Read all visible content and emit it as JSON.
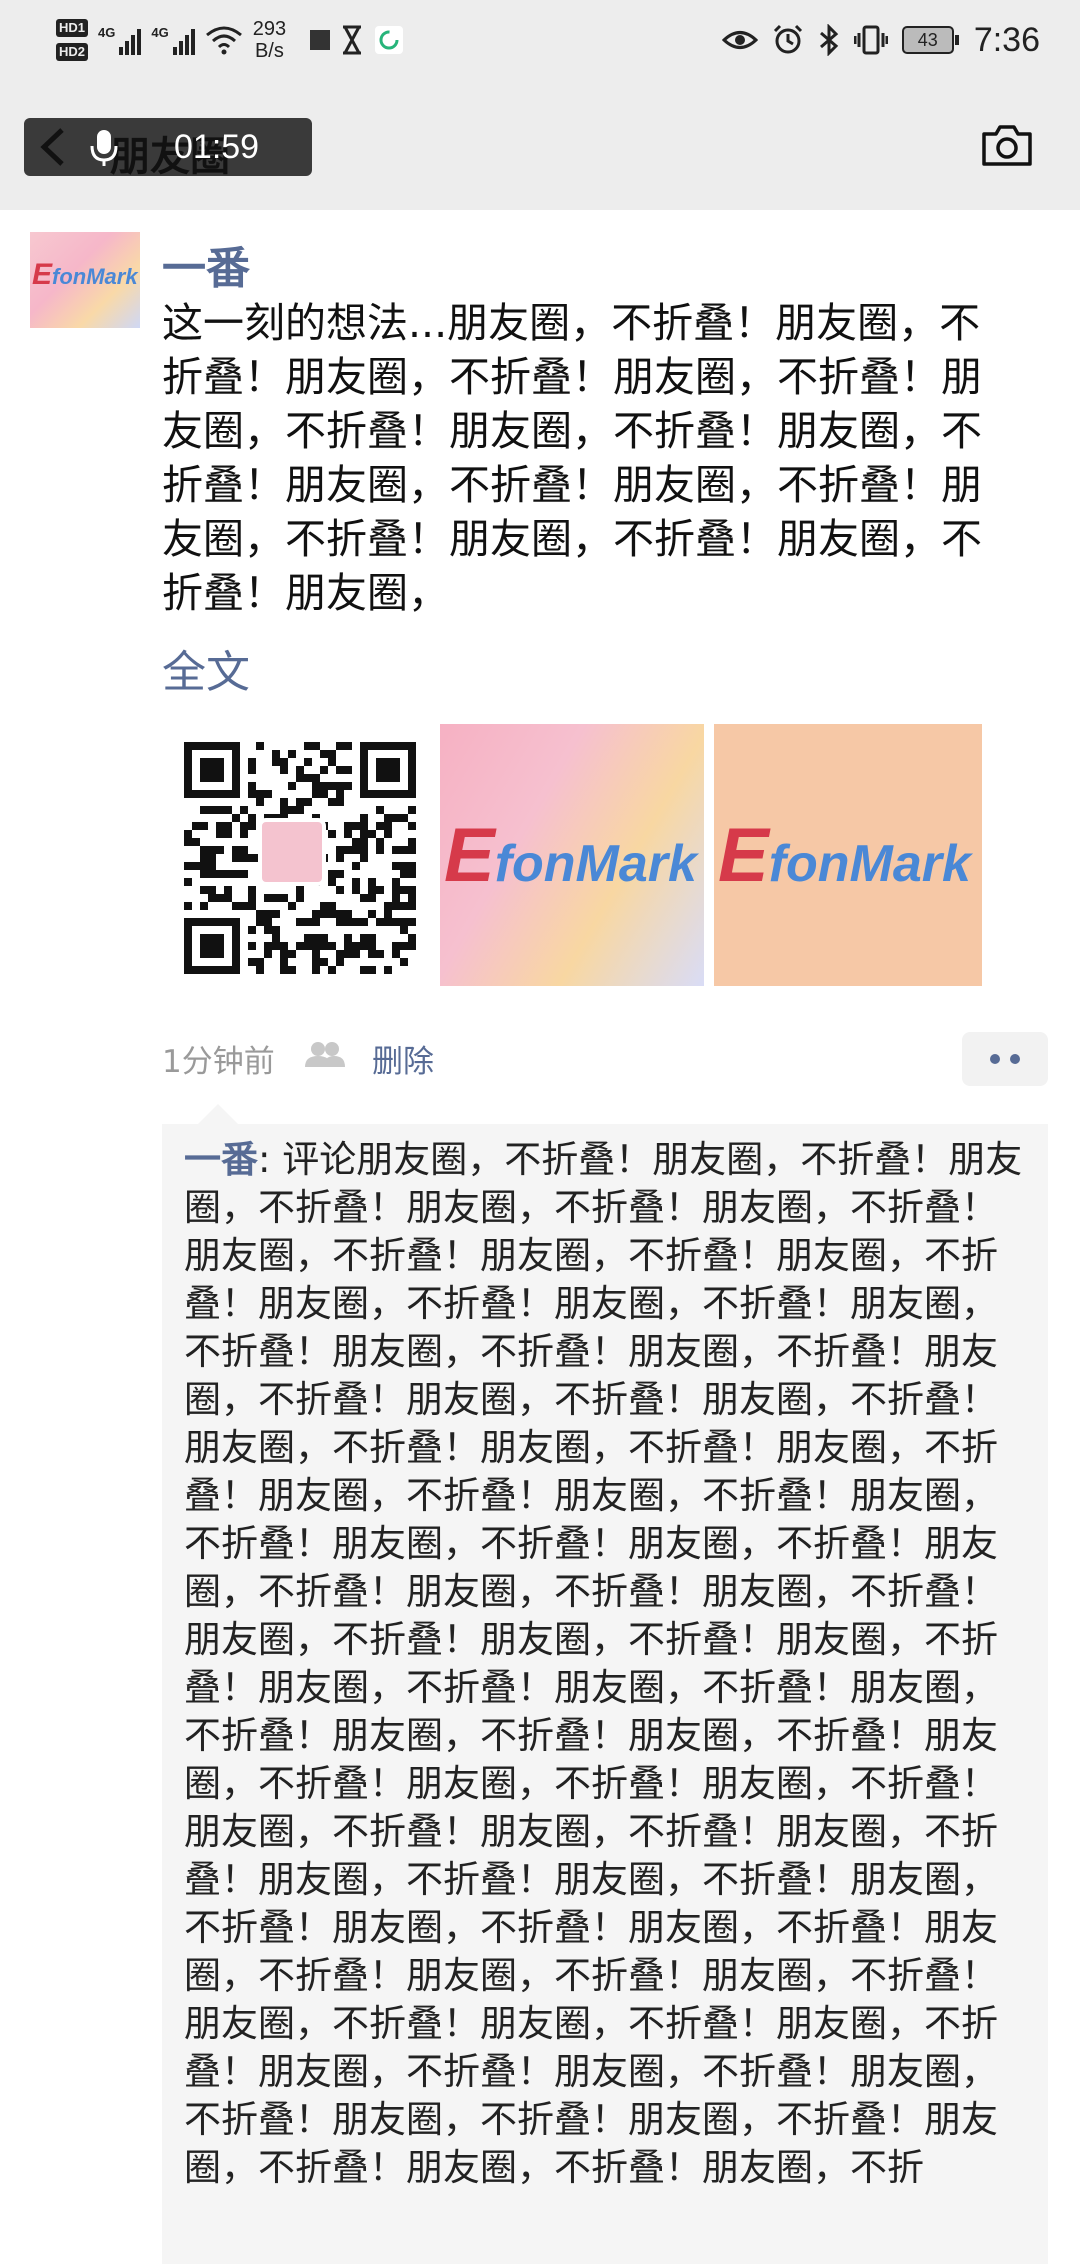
{
  "status_bar": {
    "hd1": "HD1",
    "hd2": "HD2",
    "network1": "4G",
    "network2": "4G",
    "speed_value": "293",
    "speed_unit": "B/s",
    "battery": "43",
    "time": "7:36"
  },
  "nav": {
    "title": "朋友圈",
    "timer": "01:59"
  },
  "post": {
    "author": "一番",
    "text": "这一刻的想法...朋友圈，不折叠！朋友圈，不折叠！朋友圈，不折叠！朋友圈，不折叠！朋友圈，不折叠！朋友圈，不折叠！朋友圈，不折叠！朋友圈，不折叠！朋友圈，不折叠！朋友圈，不折叠！朋友圈，不折叠！朋友圈，不折叠！朋友圈，",
    "full_text_link": "全文",
    "logo_e": "E",
    "logo_rest": "fonMark",
    "time_ago": "1分钟前",
    "delete_label": "删除"
  },
  "comments": [
    {
      "author": "一番",
      "separator": ": ",
      "text": "评论朋友圈，不折叠！朋友圈，不折叠！朋友圈，不折叠！朋友圈，不折叠！朋友圈，不折叠！朋友圈，不折叠！朋友圈，不折叠！朋友圈，不折叠！朋友圈，不折叠！朋友圈，不折叠！朋友圈，不折叠！朋友圈，不折叠！朋友圈，不折叠！朋友圈，不折叠！朋友圈，不折叠！朋友圈，不折叠！朋友圈，不折叠！朋友圈，不折叠！朋友圈，不折叠！朋友圈，不折叠！朋友圈，不折叠！朋友圈，不折叠！朋友圈，不折叠！朋友圈，不折叠！朋友圈，不折叠！朋友圈，不折叠！朋友圈，不折叠！朋友圈，不折叠！朋友圈，不折叠！朋友圈，不折叠！朋友圈，不折叠！朋友圈，不折叠！朋友圈，不折叠！朋友圈，不折叠！朋友圈，不折叠！朋友圈，不折叠！朋友圈，不折叠！朋友圈，不折叠！朋友圈，不折叠！朋友圈，不折叠！朋友圈，不折叠！朋友圈，不折叠！朋友圈，不折叠！朋友圈，不折叠！朋友圈，不折叠！朋友圈，不折叠！朋友圈，不折叠！朋友圈，不折叠！朋友圈，不折叠！朋友圈，不折叠！朋友圈，不折叠！朋友圈，不折叠！朋友圈，不折叠！朋友圈，不折叠！朋友圈，不折叠！朋友圈，不折叠！朋友圈，不折叠！朋友圈，不折叠！朋友圈，不折叠！朋友圈，不折"
    }
  ],
  "colors": {
    "link": "#576b95",
    "bar_bg": "#ededed",
    "comment_bg": "#f5f5f5",
    "logo_red": "#d63a4a",
    "logo_blue": "#4a88d6"
  },
  "icons": {
    "back": "chevron-left-icon",
    "mic": "microphone-icon",
    "camera": "camera-icon",
    "privacy": "people-icon",
    "more": "more-dots-icon",
    "eye": "eye-icon",
    "alarm": "alarm-icon",
    "bluetooth": "bluetooth-icon",
    "vibrate": "vibrate-icon",
    "wifi": "wifi-icon"
  }
}
